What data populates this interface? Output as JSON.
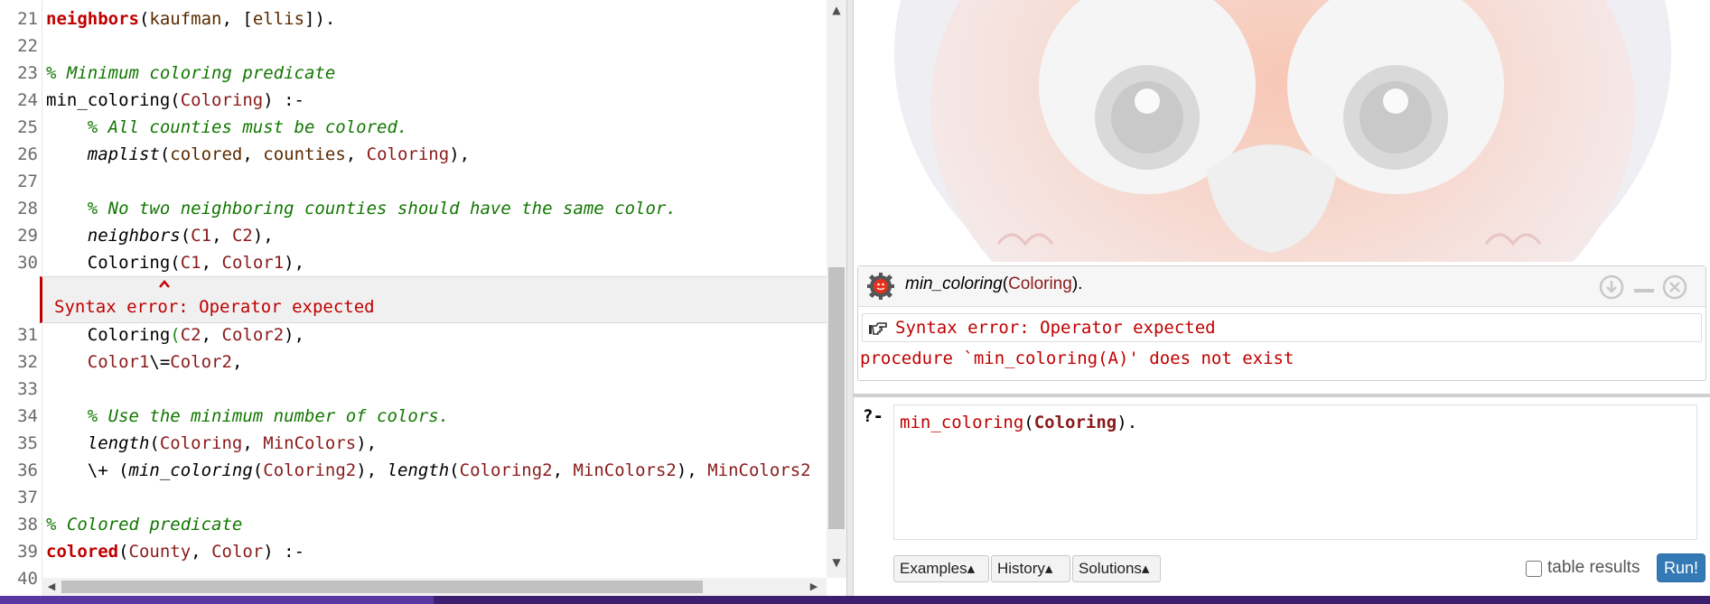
{
  "editor": {
    "lines": [
      {
        "n": "21",
        "tokens": [
          {
            "t": "neighbors",
            "c": "hd"
          },
          {
            "t": "(",
            "c": ""
          },
          {
            "t": "kaufman",
            "c": "at"
          },
          {
            "t": ", [",
            "c": ""
          },
          {
            "t": "ellis",
            "c": "at"
          },
          {
            "t": "]).",
            "c": ""
          }
        ]
      },
      {
        "n": "22",
        "tokens": []
      },
      {
        "n": "23",
        "tokens": [
          {
            "t": "% Minimum coloring predicate",
            "c": "cm"
          }
        ]
      },
      {
        "n": "24",
        "tokens": [
          {
            "t": "min_coloring(",
            "c": ""
          },
          {
            "t": "Coloring",
            "c": "vr"
          },
          {
            "t": ") :-",
            "c": ""
          }
        ]
      },
      {
        "n": "25",
        "tokens": [
          {
            "t": "    ",
            "c": ""
          },
          {
            "t": "% All counties must be colored.",
            "c": "cm"
          }
        ]
      },
      {
        "n": "26",
        "tokens": [
          {
            "t": "    ",
            "c": ""
          },
          {
            "t": "maplist",
            "c": "bi"
          },
          {
            "t": "(",
            "c": ""
          },
          {
            "t": "colored",
            "c": "at"
          },
          {
            "t": ", ",
            "c": ""
          },
          {
            "t": "counties",
            "c": "at"
          },
          {
            "t": ", ",
            "c": ""
          },
          {
            "t": "Coloring",
            "c": "vr"
          },
          {
            "t": "),",
            "c": ""
          }
        ]
      },
      {
        "n": "27",
        "tokens": []
      },
      {
        "n": "28",
        "tokens": [
          {
            "t": "    ",
            "c": ""
          },
          {
            "t": "% No two neighboring counties should have the same color.",
            "c": "cm"
          }
        ]
      },
      {
        "n": "29",
        "tokens": [
          {
            "t": "    ",
            "c": ""
          },
          {
            "t": "neighbors",
            "c": "bi"
          },
          {
            "t": "(",
            "c": ""
          },
          {
            "t": "C1",
            "c": "vr"
          },
          {
            "t": ", ",
            "c": ""
          },
          {
            "t": "C2",
            "c": "vr"
          },
          {
            "t": "),",
            "c": ""
          }
        ]
      },
      {
        "n": "30",
        "tokens": [
          {
            "t": "    Coloring(",
            "c": ""
          },
          {
            "t": "C1",
            "c": "vr"
          },
          {
            "t": ", ",
            "c": ""
          },
          {
            "t": "Color1",
            "c": "vr"
          },
          {
            "t": "),",
            "c": ""
          }
        ]
      },
      {
        "n": "31",
        "tokens": [
          {
            "t": "    Coloring",
            "c": ""
          },
          {
            "t": "(",
            "c": "ok"
          },
          {
            "t": "C2",
            "c": "vr"
          },
          {
            "t": ", ",
            "c": ""
          },
          {
            "t": "Color2",
            "c": "vr"
          },
          {
            "t": "),",
            "c": ""
          }
        ]
      },
      {
        "n": "32",
        "tokens": [
          {
            "t": "    ",
            "c": ""
          },
          {
            "t": "Color1",
            "c": "vr"
          },
          {
            "t": "\\=",
            "c": ""
          },
          {
            "t": "Color2",
            "c": "vr"
          },
          {
            "t": ",",
            "c": ""
          }
        ]
      },
      {
        "n": "33",
        "tokens": []
      },
      {
        "n": "34",
        "tokens": [
          {
            "t": "    ",
            "c": ""
          },
          {
            "t": "% Use the minimum number of colors.",
            "c": "cm"
          }
        ]
      },
      {
        "n": "35",
        "tokens": [
          {
            "t": "    ",
            "c": ""
          },
          {
            "t": "length",
            "c": "bi"
          },
          {
            "t": "(",
            "c": ""
          },
          {
            "t": "Coloring",
            "c": "vr"
          },
          {
            "t": ", ",
            "c": ""
          },
          {
            "t": "MinColors",
            "c": "vr"
          },
          {
            "t": "),",
            "c": ""
          }
        ]
      },
      {
        "n": "36",
        "tokens": [
          {
            "t": "    \\+ (",
            "c": ""
          },
          {
            "t": "min_coloring",
            "c": "bi"
          },
          {
            "t": "(",
            "c": ""
          },
          {
            "t": "Coloring2",
            "c": "vr"
          },
          {
            "t": "), ",
            "c": ""
          },
          {
            "t": "length",
            "c": "bi"
          },
          {
            "t": "(",
            "c": ""
          },
          {
            "t": "Coloring2",
            "c": "vr"
          },
          {
            "t": ", ",
            "c": ""
          },
          {
            "t": "MinColors2",
            "c": "vr"
          },
          {
            "t": "), ",
            "c": ""
          },
          {
            "t": "MinColors2",
            "c": "vr"
          }
        ]
      },
      {
        "n": "37",
        "tokens": []
      },
      {
        "n": "38",
        "tokens": [
          {
            "t": "% Colored predicate",
            "c": "cm"
          }
        ]
      },
      {
        "n": "39",
        "tokens": [
          {
            "t": "colored",
            "c": "hd"
          },
          {
            "t": "(",
            "c": ""
          },
          {
            "t": "County",
            "c": "vr"
          },
          {
            "t": ", ",
            "c": ""
          },
          {
            "t": "Color",
            "c": "vr"
          },
          {
            "t": ") :-",
            "c": ""
          }
        ]
      },
      {
        "n": "40",
        "tokens": []
      }
    ],
    "inline_error": "Syntax error: Operator expected"
  },
  "query": {
    "name": "min_coloring",
    "arg": "Coloring",
    "suffix": ").",
    "response_error": "Syntax error: Operator expected",
    "response_message": "procedure `min_coloring(A)' does not exist"
  },
  "console": {
    "prompt": "?-",
    "input_head": "min_coloring",
    "input_open": "(",
    "input_arg": "Coloring",
    "input_close": ")."
  },
  "controls": {
    "examples_label": "Examples▴",
    "history_label": "History▴",
    "solutions_label": "Solutions▴",
    "table_results_label": "table results",
    "table_results_checked": false,
    "run_label": "Run!"
  },
  "colors": {
    "error": "#c00000",
    "comment": "#117700",
    "variable": "#8a1b1b",
    "run_button": "#337ab7"
  }
}
